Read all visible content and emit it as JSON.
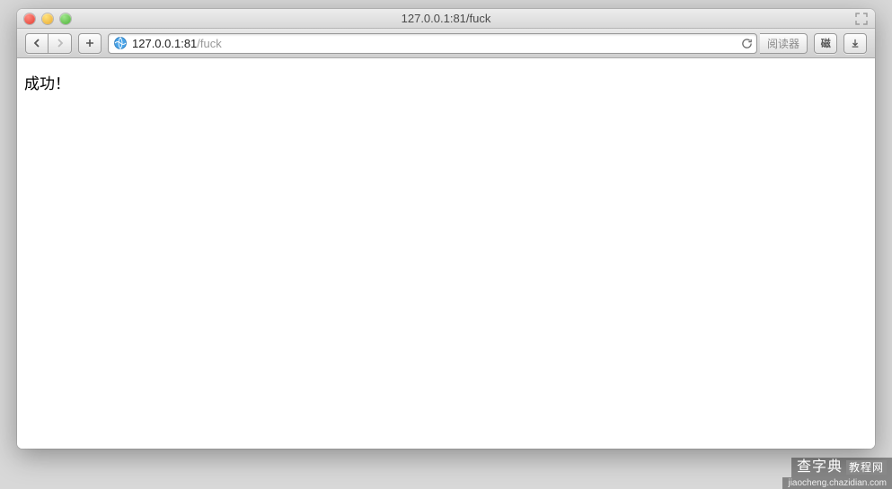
{
  "window": {
    "title": "127.0.0.1:81/fuck"
  },
  "toolbar": {
    "address_display_host": "127.0.0.1:81",
    "address_display_path": "/fuck",
    "reader_label": "阅读器",
    "magnet_label": "磁"
  },
  "page": {
    "body_text": "成功！"
  },
  "watermark": {
    "brand": "查字典",
    "brand_suffix": "教程网",
    "url": "jiaocheng.chazidian.com"
  }
}
